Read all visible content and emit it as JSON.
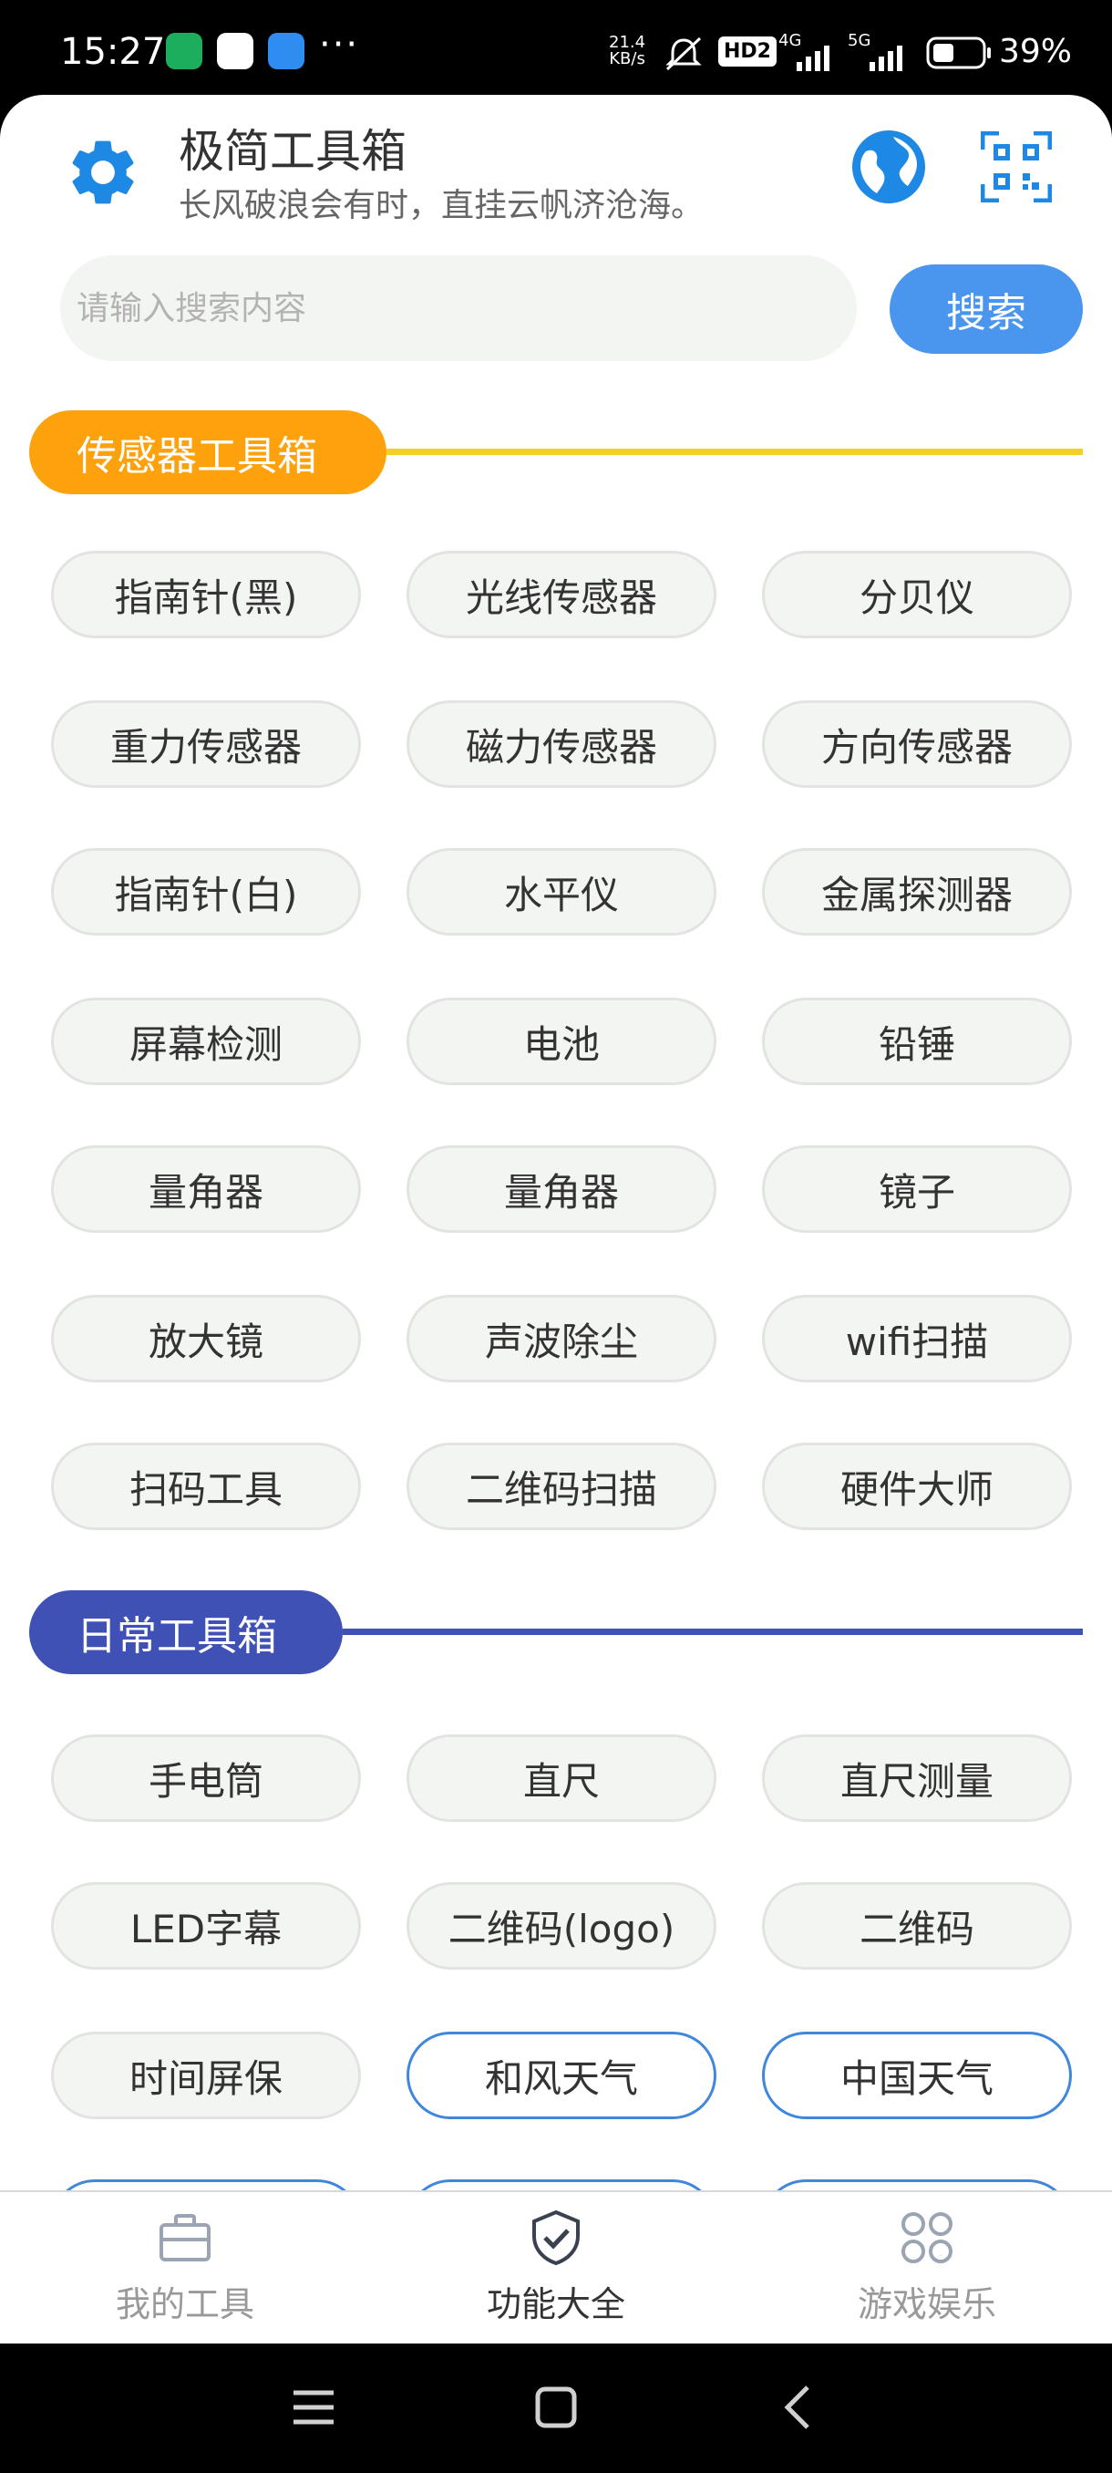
{
  "status_bar": {
    "time": "15:27",
    "dots": "···",
    "net_speed_value": "21.4",
    "net_speed_unit": "KB/s",
    "hd_label": "HD2",
    "signal1_label": "4G",
    "signal2_label": "5G",
    "battery_text": "39%"
  },
  "header": {
    "title": "极简工具箱",
    "subtitle": "长风破浪会有时，直挂云帆济沧海。",
    "settings_icon": "gear-icon",
    "globe_icon": "globe-icon",
    "qr_icon": "qr-scan-icon"
  },
  "search": {
    "placeholder": "请输入搜索内容",
    "value": "",
    "button_label": "搜索"
  },
  "sections": [
    {
      "title": "传感器工具箱",
      "color": "#fda20c",
      "line_color": "#f5d024",
      "items": [
        {
          "label": "指南针(黑)"
        },
        {
          "label": "光线传感器"
        },
        {
          "label": "分贝仪"
        },
        {
          "label": "重力传感器"
        },
        {
          "label": "磁力传感器"
        },
        {
          "label": "方向传感器"
        },
        {
          "label": "指南针(白)"
        },
        {
          "label": "水平仪"
        },
        {
          "label": "金属探测器"
        },
        {
          "label": "屏幕检测"
        },
        {
          "label": "电池"
        },
        {
          "label": "铅锤"
        },
        {
          "label": "量角器"
        },
        {
          "label": "量角器"
        },
        {
          "label": "镜子"
        },
        {
          "label": "放大镜"
        },
        {
          "label": "声波除尘"
        },
        {
          "label": "wifi扫描"
        },
        {
          "label": "扫码工具"
        },
        {
          "label": "二维码扫描"
        },
        {
          "label": "硬件大师"
        }
      ]
    },
    {
      "title": "日常工具箱",
      "color": "#3f51b5",
      "line_color": "#3f51b5",
      "items": [
        {
          "label": "手电筒"
        },
        {
          "label": "直尺"
        },
        {
          "label": "直尺测量"
        },
        {
          "label": "LED字幕"
        },
        {
          "label": "二维码(logo)"
        },
        {
          "label": "二维码"
        },
        {
          "label": "时间屏保"
        },
        {
          "label": "和风天气",
          "outlined": true
        },
        {
          "label": "中国天气",
          "outlined": true
        }
      ]
    }
  ],
  "bottom_nav": [
    {
      "label": "我的工具",
      "icon": "briefcase-icon",
      "active": false
    },
    {
      "label": "功能大全",
      "icon": "shield-check-icon",
      "active": true
    },
    {
      "label": "游戏娱乐",
      "icon": "grid-icon",
      "active": false
    }
  ],
  "colors": {
    "accent_blue": "#4a95ee",
    "icon_blue": "#1e88e5",
    "button_bg": "#f3f5f2"
  }
}
